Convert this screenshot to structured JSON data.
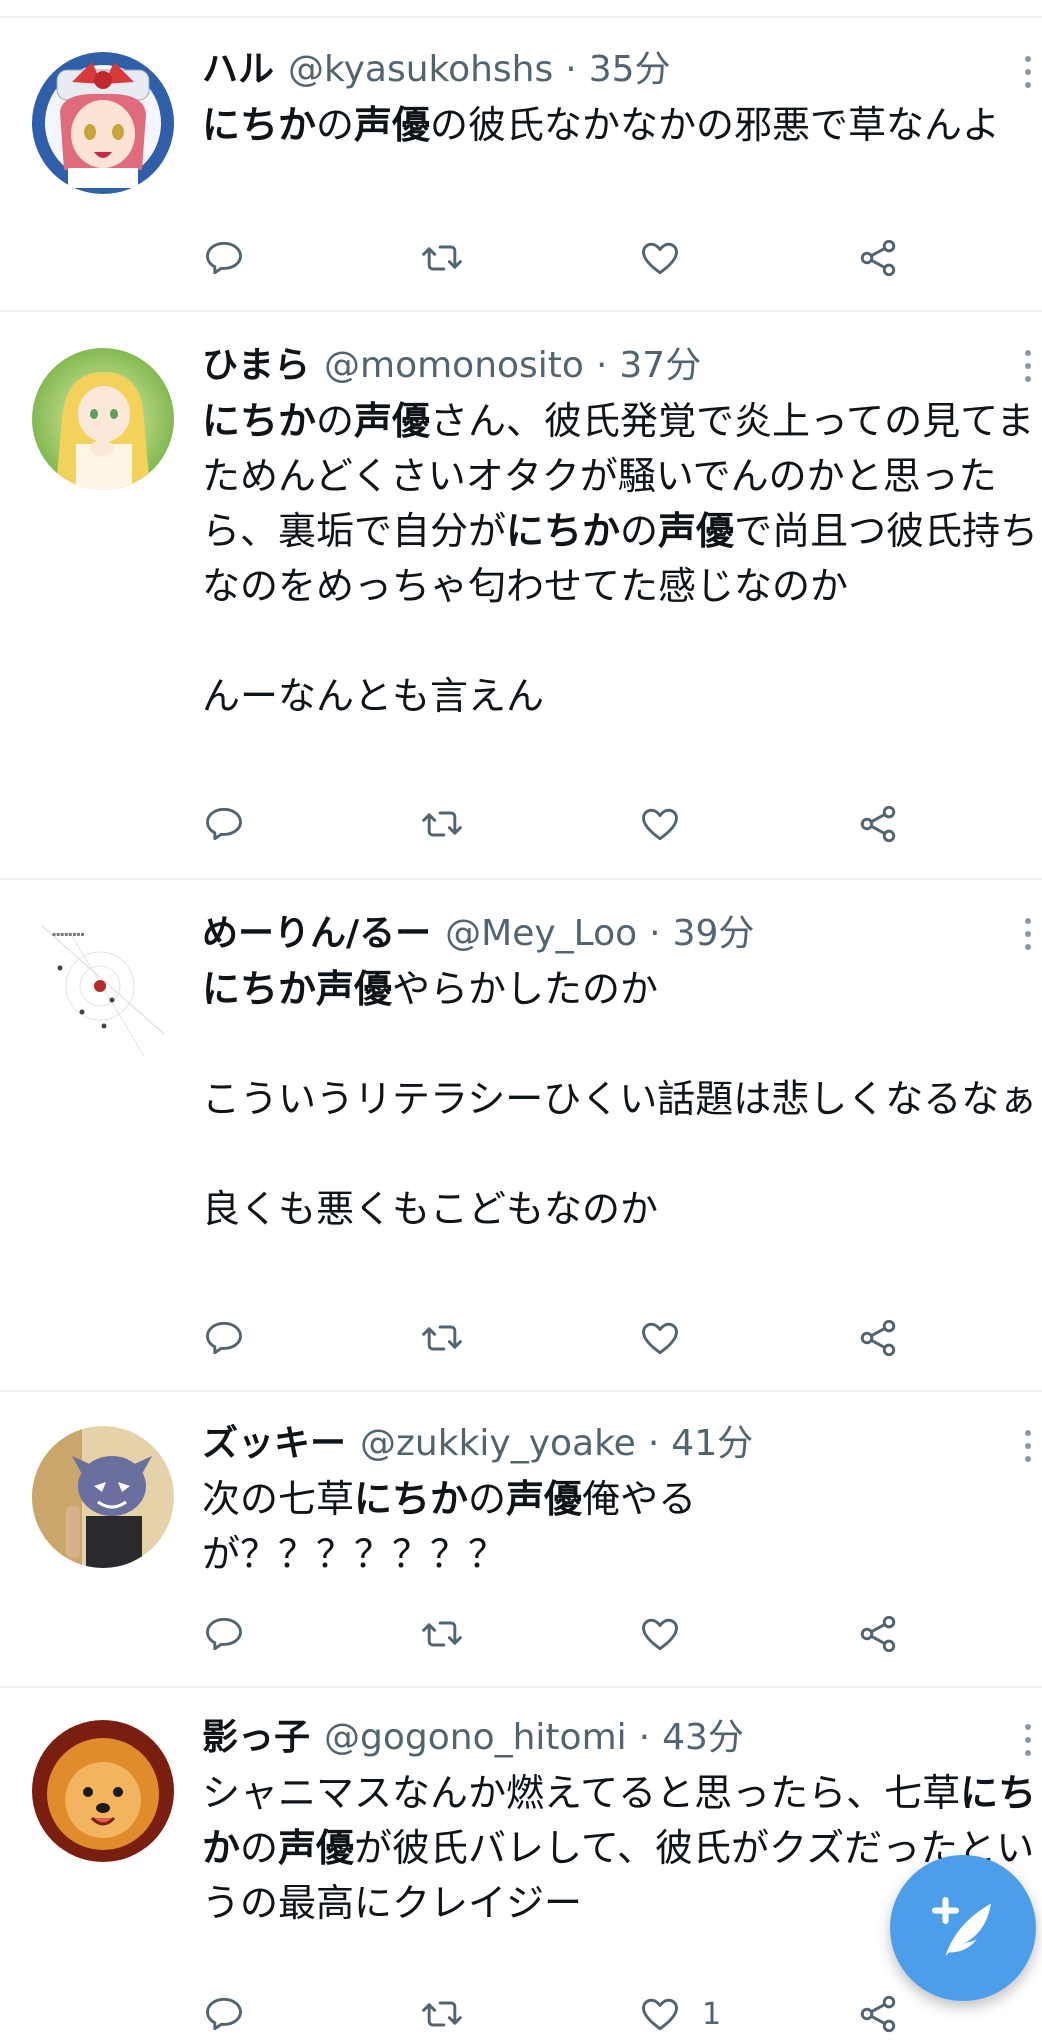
{
  "tweets": [
    {
      "name": "ハル",
      "handle": "@kyasukohshs",
      "dot": "·",
      "time": "35分",
      "text_html": "<b>にちか</b>の<b>声優</b>の彼氏なかなかの邪悪で草なんよ",
      "likes": ""
    },
    {
      "name": "ひまら",
      "handle": "@momonosito",
      "dot": "·",
      "time": "37分",
      "text_html": "<b>にちか</b>の<b>声優</b>さん、彼氏発覚で炎上っての見てまためんどくさいオタクが騒いでんのかと思ったら、裏垢で自分が<b>にちか</b>の<b>声優</b>で尚且つ彼氏持ちなのをめっちゃ匂わせてた感じなのか\n\nんーなんとも言えん",
      "likes": ""
    },
    {
      "name": "めーりん/るー",
      "handle": "@Mey_Loo",
      "dot": "·",
      "time": "39分",
      "text_html": "<b>にちか声優</b>やらかしたのか\n\nこういうリテラシーひくい話題は悲しくなるなぁ\n\n良くも悪くもこどもなのか",
      "likes": ""
    },
    {
      "name": "ズッキー",
      "handle": "@zukkiy_yoake",
      "dot": "·",
      "time": "41分",
      "text_html": "次の七草<b>にちか</b>の<b>声優</b>俺やる\nが？？？？？？？",
      "likes": ""
    },
    {
      "name": "影っ子",
      "handle": "@gogono_hitomi",
      "dot": "·",
      "time": "43分",
      "text_html": "シャニマスなんか燃えてると思ったら、七草<b>にちか</b>の<b>声優</b>が彼氏バレして、彼氏がクズだったというの最高にクレイジー",
      "likes": "1"
    }
  ],
  "icons": {
    "reply": "reply-icon",
    "retweet": "retweet-icon",
    "like": "heart-icon",
    "share": "share-icon",
    "more": "more-options-icon",
    "compose": "compose-tweet-icon"
  },
  "colors": {
    "accent": "#4c9eeb",
    "text": "#0f1419",
    "secondary": "#536471",
    "divider": "#eff3f4"
  }
}
